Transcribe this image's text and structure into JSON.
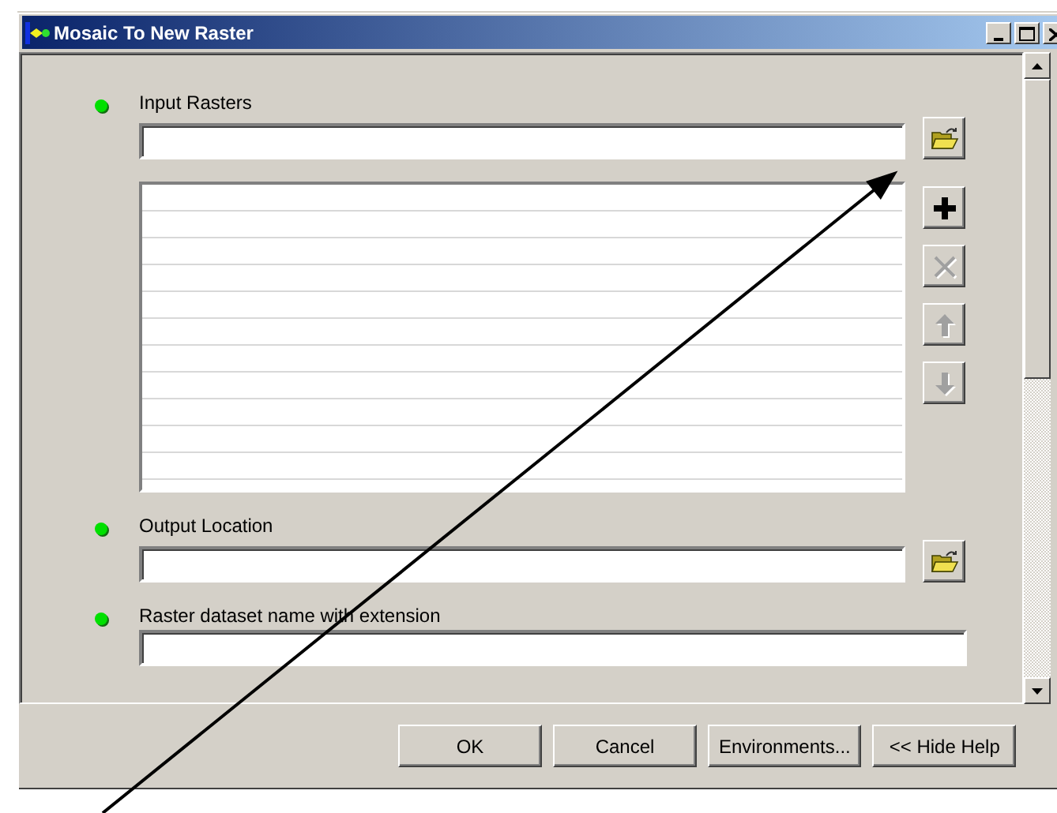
{
  "window": {
    "title": "Mosaic To New Raster"
  },
  "parameters": [
    {
      "kind": "list",
      "label": "Input Rasters",
      "required": true
    },
    {
      "kind": "folder",
      "label": "Output Location",
      "required": true
    },
    {
      "kind": "text",
      "label": "Raster dataset name with extension",
      "required": true
    }
  ],
  "list_tools": [
    {
      "kind": "add",
      "disabled": false
    },
    {
      "kind": "remove",
      "disabled": true
    },
    {
      "kind": "up",
      "disabled": true
    },
    {
      "kind": "down",
      "disabled": true
    }
  ],
  "buttons": [
    "OK",
    "Cancel",
    "Environments...",
    "<< Hide Help"
  ]
}
